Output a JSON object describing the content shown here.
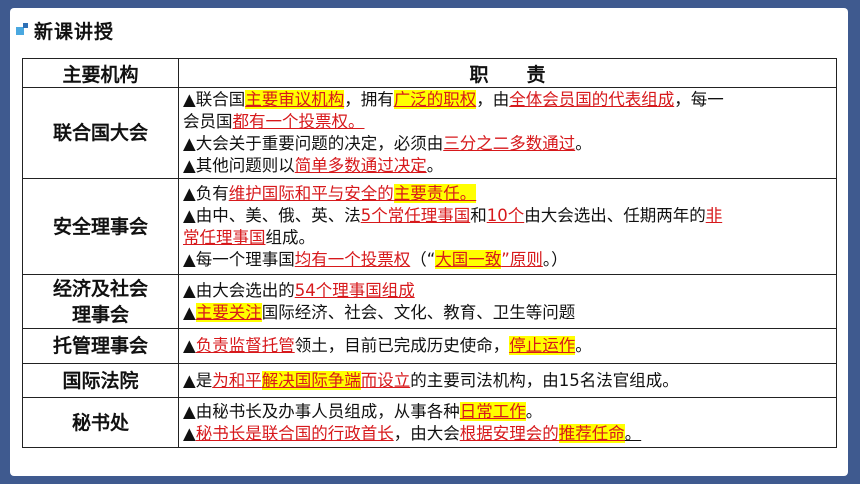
{
  "header": {
    "title": "新课讲授"
  },
  "table": {
    "col_org": "主要机构",
    "col_duty": "职　　责",
    "rows": [
      {
        "org": [
          "联合国大会"
        ],
        "lines": [
          [
            {
              "t": "▲联合国"
            },
            {
              "t": "主要审议机构",
              "s": "hl"
            },
            {
              "t": "，拥有"
            },
            {
              "t": "广泛的职权",
              "s": "hl"
            },
            {
              "t": "，由"
            },
            {
              "t": "全体会员国的代表组成",
              "s": "red"
            },
            {
              "t": "，每一"
            }
          ],
          [
            {
              "t": "会员国"
            },
            {
              "t": "都有一个投票权。",
              "s": "red"
            }
          ],
          [
            {
              "t": "▲大会关于重要问题的决定，必须由"
            },
            {
              "t": "三分之二多数通过",
              "s": "red"
            },
            {
              "t": "。"
            }
          ],
          [
            {
              "t": "▲其他问题则以"
            },
            {
              "t": "简单多数通过决定",
              "s": "red"
            },
            {
              "t": "。"
            }
          ]
        ]
      },
      {
        "org": [
          "安全理事会"
        ],
        "lines": [
          [
            {
              "t": "▲负有"
            },
            {
              "t": "维护国际和平与安全的",
              "s": "red"
            },
            {
              "t": "主要责任。",
              "s": "hl"
            }
          ],
          [
            {
              "t": "▲由中、美、俄、英、法"
            },
            {
              "t": "5个常任理事国",
              "s": "red"
            },
            {
              "t": "和"
            },
            {
              "t": "10个",
              "s": "red"
            },
            {
              "t": "由大会选出、任期两年的"
            },
            {
              "t": "非",
              "s": "red"
            }
          ],
          [
            {
              "t": "常任理事国",
              "s": "red"
            },
            {
              "t": "组成。"
            }
          ],
          [
            {
              "t": "▲每一个理事国"
            },
            {
              "t": "均有一个投票权",
              "s": "red"
            },
            {
              "t": "（“"
            },
            {
              "t": "大国一致",
              "s": "hl"
            },
            {
              "t": "”原则",
              "s": "red"
            },
            {
              "t": "。）"
            }
          ]
        ]
      },
      {
        "org": [
          "经济及社会",
          "理事会"
        ],
        "lines": [
          [
            {
              "t": "▲由大会选出的"
            },
            {
              "t": "54个理事国组成",
              "s": "red"
            }
          ],
          [
            {
              "t": "▲"
            },
            {
              "t": "主要关注",
              "s": "hl"
            },
            {
              "t": "国际经济、社会、文化、教育、卫生等问题"
            }
          ]
        ]
      },
      {
        "org": [
          "托管理事会"
        ],
        "lines": [
          [
            {
              "t": "▲"
            },
            {
              "t": "负责监督托管",
              "s": "red"
            },
            {
              "t": "领土，目前已完成历史使命，"
            },
            {
              "t": "停止运作",
              "s": "hl"
            },
            {
              "t": "。"
            }
          ]
        ]
      },
      {
        "org": [
          "国际法院"
        ],
        "lines": [
          [
            {
              "t": "▲是"
            },
            {
              "t": "为和平",
              "s": "red"
            },
            {
              "t": "解决国际争端",
              "s": "hl"
            },
            {
              "t": "而设立",
              "s": "red"
            },
            {
              "t": "的主要司法机构，由15名法官组成。"
            }
          ]
        ]
      },
      {
        "org": [
          "秘书处"
        ],
        "lines": [
          [
            {
              "t": "▲由秘书长及办事人员组成，从事各种"
            },
            {
              "t": "日常工作",
              "s": "hl"
            },
            {
              "t": "。"
            }
          ],
          [
            {
              "t": "▲"
            },
            {
              "t": "秘书长是联合国的行政首长",
              "s": "red"
            },
            {
              "t": "，由大会"
            },
            {
              "t": "根据安理会的",
              "s": "red"
            },
            {
              "t": "推荐任命",
              "s": "hl"
            },
            {
              "t": "。",
              "s": "blk"
            }
          ]
        ]
      }
    ]
  }
}
